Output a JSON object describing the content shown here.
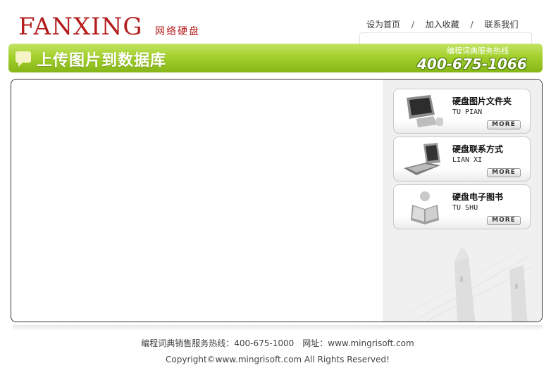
{
  "header": {
    "logo_text": "FANXING",
    "logo_sub": "网络硬盘",
    "links": [
      "设为首页",
      "加入收藏",
      "联系我们"
    ],
    "separator": "/"
  },
  "banner": {
    "title": "上传图片到数据库",
    "hotline_label": "编程词典服务热线",
    "hotline_number": "400-675-1066"
  },
  "sidebar": {
    "cards": [
      {
        "title": "硬盘图片文件夹",
        "subtitle": "TU PIAN",
        "more_label": "MORE",
        "icon": "computer-icon"
      },
      {
        "title": "硬盘联系方式",
        "subtitle": "LIAN XI",
        "more_label": "MORE",
        "icon": "phone-icon"
      },
      {
        "title": "硬盘电子图书",
        "subtitle": "TU SHU",
        "more_label": "MORE",
        "icon": "reader-icon"
      }
    ]
  },
  "footer": {
    "line1": "编程词典销售服务热线：400-675-1000　网址：www.mingrisoft.com",
    "line2": "Copyright©www.mingrisoft.com  All Rights Reserved!"
  },
  "colors": {
    "brand_red": "#b51d1d",
    "banner_green": "#a3d02c",
    "panel_border": "#333333"
  }
}
